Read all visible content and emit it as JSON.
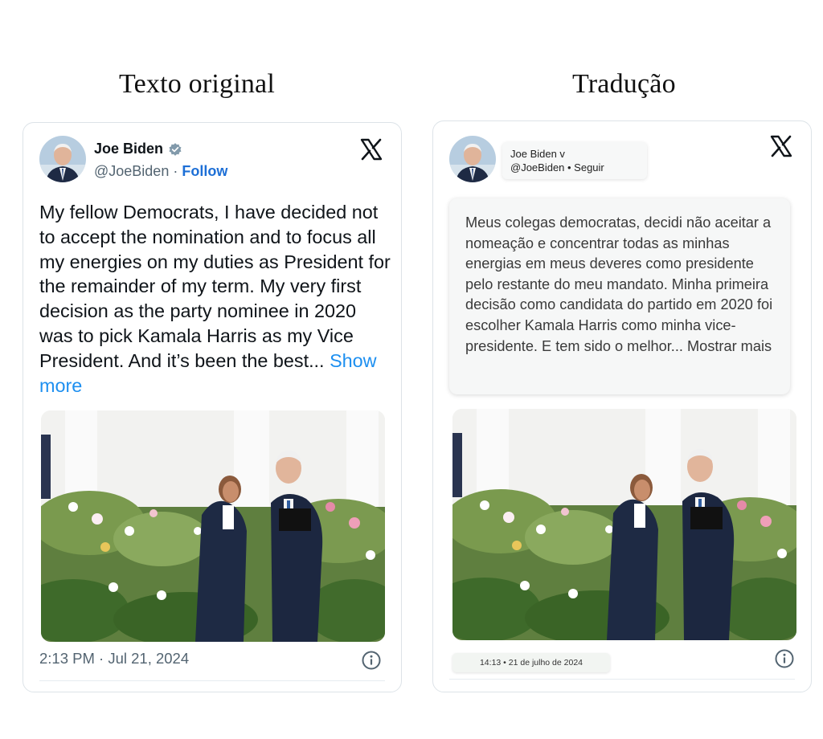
{
  "headings": {
    "left": "Texto original",
    "right": "Tradução"
  },
  "original": {
    "name": "Joe Biden",
    "handle": "@JoeBiden",
    "separator": "·",
    "follow": "Follow",
    "body": "My fellow Democrats, I have decided not to accept the nomination and to focus all my energies on my duties as President for the remainder of my term. My very first decision as the party nominee in 2020 was to pick Kamala Harris as my Vice President. And it’s been the best...",
    "show_more": "Show more",
    "timestamp": "2:13 PM · Jul 21, 2024"
  },
  "translation": {
    "name": "Joe Biden v",
    "handle_line": "@JoeBiden • Seguir",
    "body": "Meus colegas democratas, decidi não aceitar a nomeação e concentrar todas as minhas energias em meus deveres como presidente pelo restante do meu mandato. Minha primeira decisão como candidata do partido em 2020 foi escolher Kamala Harris como minha vice-presidente. E tem sido o melhor... Mostrar mais",
    "timestamp": "14:13 • 21 de julho de 2024"
  },
  "icons": {
    "verified": "verified-badge-icon",
    "brand": "x-logo-icon",
    "info": "info-icon"
  },
  "colors": {
    "accent": "#1d8ff0",
    "follow": "#1d6fd6",
    "muted": "#536471",
    "border": "#dde3e8"
  }
}
